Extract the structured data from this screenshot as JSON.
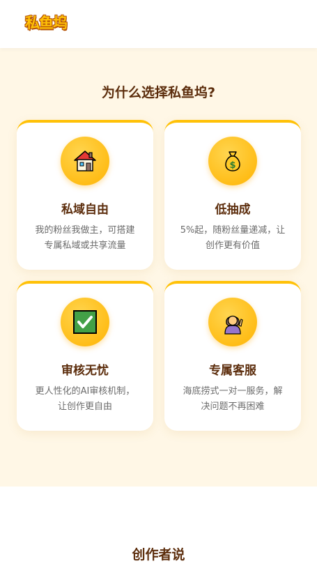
{
  "header": {
    "logo_text": "私鱼坞"
  },
  "features": {
    "title": "为什么选择私鱼坞?",
    "cards": [
      {
        "icon": "house-icon",
        "title": "私域自由",
        "desc": "我的粉丝我做主，可搭建专属私域或共享流量"
      },
      {
        "icon": "money-bag-icon",
        "title": "低抽成",
        "desc": "5%起，随粉丝量递减，让创作更有价值"
      },
      {
        "icon": "check-mark-icon",
        "title": "审核无忧",
        "desc": "更人性化的AI审核机制，让创作更自由"
      },
      {
        "icon": "support-person-icon",
        "title": "专属客服",
        "desc": "海底捞式一对一服务，解决问题不再困难"
      }
    ]
  },
  "creators": {
    "title": "创作者说"
  },
  "colors": {
    "accent": "#ffc107",
    "title": "#5c2d0c",
    "section_bg": "#fff7e6"
  }
}
